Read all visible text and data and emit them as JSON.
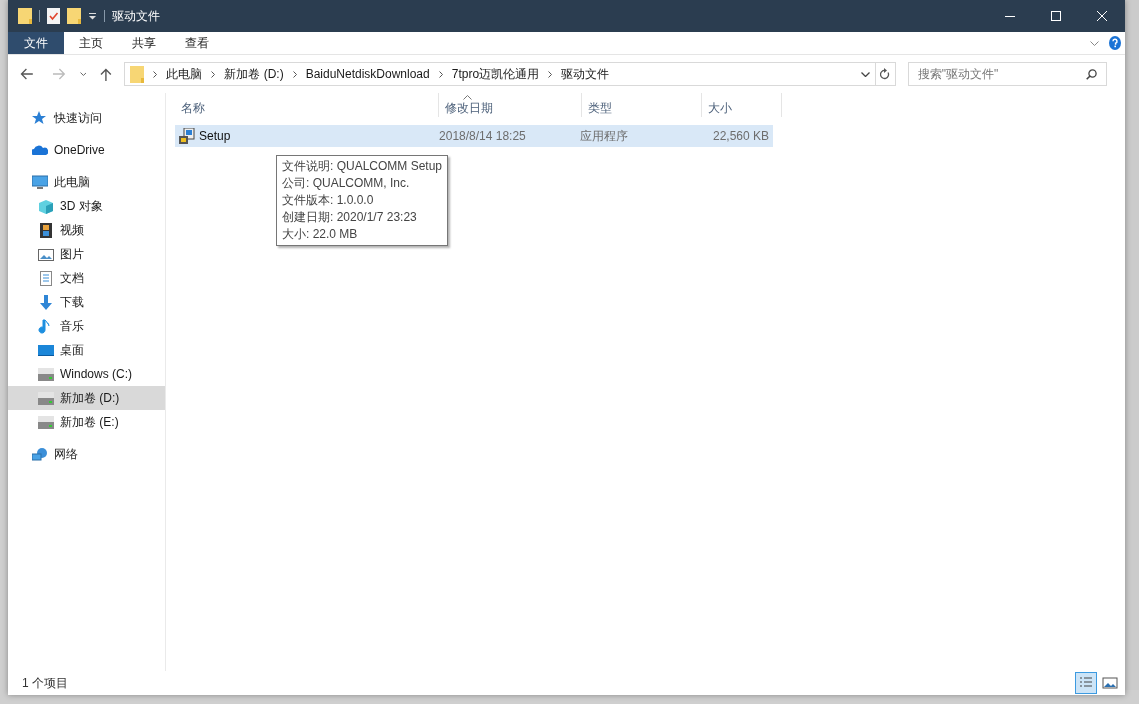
{
  "window": {
    "title": "驱动文件"
  },
  "ribbon_tabs": [
    {
      "label": "文件",
      "selected": true
    },
    {
      "label": "主页",
      "selected": false
    },
    {
      "label": "共享",
      "selected": false
    },
    {
      "label": "查看",
      "selected": false
    }
  ],
  "address_bar": {
    "segments": [
      "此电脑",
      "新加卷 (D:)",
      "BaiduNetdiskDownload",
      "7tpro迈凯伦通用",
      "驱动文件"
    ]
  },
  "search": {
    "placeholder": "搜索\"驱动文件\""
  },
  "sidebar": {
    "items": [
      {
        "label": "快速访问",
        "kind": "star",
        "selected": false
      },
      {
        "label": "OneDrive",
        "kind": "cloud",
        "selected": false
      },
      {
        "label": "此电脑",
        "kind": "pc",
        "selected": false,
        "children": [
          {
            "label": "3D 对象",
            "kind": "cube",
            "selected": false
          },
          {
            "label": "视频",
            "kind": "film",
            "selected": false
          },
          {
            "label": "图片",
            "kind": "picture",
            "selected": false
          },
          {
            "label": "文档",
            "kind": "document",
            "selected": false
          },
          {
            "label": "下载",
            "kind": "download",
            "selected": false
          },
          {
            "label": "音乐",
            "kind": "music",
            "selected": false
          },
          {
            "label": "桌面",
            "kind": "desktop",
            "selected": false
          },
          {
            "label": "Windows (C:)",
            "kind": "drive",
            "selected": false
          },
          {
            "label": "新加卷 (D:)",
            "kind": "drive",
            "selected": true
          },
          {
            "label": "新加卷 (E:)",
            "kind": "drive",
            "selected": false
          }
        ]
      },
      {
        "label": "网络",
        "kind": "network",
        "selected": false
      }
    ]
  },
  "table": {
    "columns": [
      "名称",
      "修改日期",
      "类型",
      "大小"
    ],
    "rows": [
      {
        "cells": [
          "Setup",
          "2018/8/14 18:25",
          "应用程序",
          "22,560 KB"
        ],
        "selected": true
      }
    ]
  },
  "tooltip": {
    "lines": [
      "文件说明: QUALCOMM Setup",
      "公司: QUALCOMM, Inc.",
      "文件版本: 1.0.0.0",
      "创建日期: 2020/1/7 23:23",
      "大小: 22.0 MB"
    ]
  },
  "status_bar": {
    "text": "1 个项目",
    "views": [
      {
        "kind": "details",
        "selected": true
      },
      {
        "kind": "large-icons",
        "selected": false
      }
    ]
  }
}
